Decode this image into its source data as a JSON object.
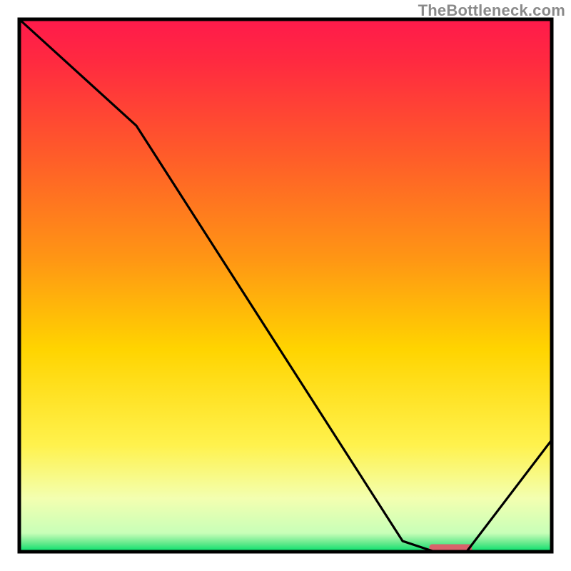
{
  "watermark": "TheBottleneck.com",
  "chart_data": {
    "type": "line",
    "title": "",
    "xlabel": "",
    "ylabel": "",
    "xlim": [
      0,
      100
    ],
    "ylim": [
      0,
      100
    ],
    "curve": [
      {
        "x": 0,
        "y": 100
      },
      {
        "x": 22,
        "y": 80
      },
      {
        "x": 72,
        "y": 2
      },
      {
        "x": 78,
        "y": 0
      },
      {
        "x": 84,
        "y": 0
      },
      {
        "x": 100,
        "y": 21
      }
    ],
    "optimal_marker": {
      "x_start": 77,
      "x_end": 85,
      "y": 0.6
    },
    "gradient_stops": [
      {
        "offset": 0.0,
        "color": "#ff1a4b"
      },
      {
        "offset": 0.08,
        "color": "#ff2a40"
      },
      {
        "offset": 0.25,
        "color": "#ff5a2a"
      },
      {
        "offset": 0.45,
        "color": "#ff9614"
      },
      {
        "offset": 0.62,
        "color": "#ffd400"
      },
      {
        "offset": 0.8,
        "color": "#fff24d"
      },
      {
        "offset": 0.9,
        "color": "#f3ffb0"
      },
      {
        "offset": 0.965,
        "color": "#c8ffb8"
      },
      {
        "offset": 0.985,
        "color": "#5fe88a"
      },
      {
        "offset": 1.0,
        "color": "#00e06a"
      }
    ],
    "marker_color": "#d9626b",
    "border_color": "#000000",
    "curve_color": "#000000"
  }
}
